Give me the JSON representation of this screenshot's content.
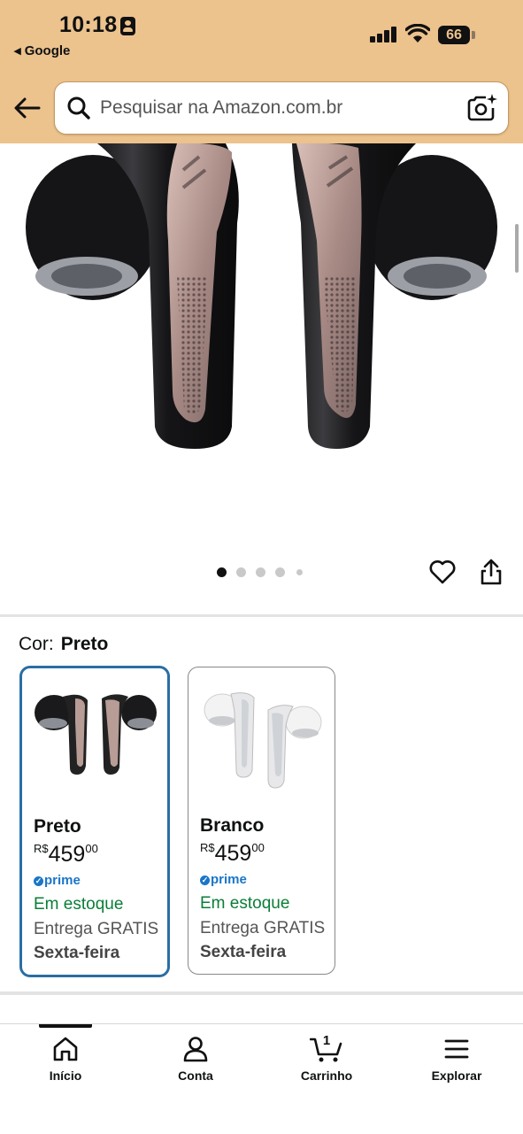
{
  "status_bar": {
    "time": "10:18",
    "back_app": "◂ Google",
    "battery": "66"
  },
  "search": {
    "placeholder": "Pesquisar na Amazon.com.br"
  },
  "gallery": {
    "image_count": 5,
    "active_index": 0
  },
  "color": {
    "label": "Cor:",
    "selected": "Preto"
  },
  "variants": [
    {
      "name": "Preto",
      "currency": "R$",
      "price_whole": "459",
      "price_cents": "00",
      "prime": "prime",
      "stock": "Em estoque",
      "shipping": "Entrega GRATIS",
      "delivery_day": "Sexta-feira"
    },
    {
      "name": "Branco",
      "currency": "R$",
      "price_whole": "459",
      "price_cents": "00",
      "prime": "prime",
      "stock": "Em estoque",
      "shipping": "Entrega GRATIS",
      "delivery_day": "Sexta-feira"
    }
  ],
  "nav": {
    "home": "Início",
    "account": "Conta",
    "cart": "Carrinho",
    "cart_count": "1",
    "explore": "Explorar"
  },
  "colors": {
    "header_bg": "#ecc28d",
    "selected_border": "#2a6ea4",
    "in_stock": "#0a7e37",
    "prime_blue": "#1a76c8"
  }
}
